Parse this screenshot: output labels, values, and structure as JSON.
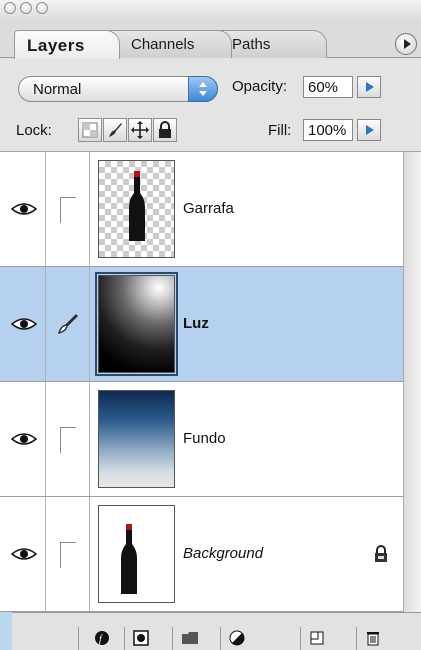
{
  "window": {
    "buttons": [
      "close",
      "minimize",
      "zoom"
    ]
  },
  "tabs": [
    {
      "label": "Layers",
      "active": true
    },
    {
      "label": "Channels",
      "active": false
    },
    {
      "label": "Paths",
      "active": false
    }
  ],
  "blend": {
    "mode": "Normal",
    "opacity_label": "Opacity:",
    "opacity_value": "60%"
  },
  "lock": {
    "label": "Lock:",
    "fill_label": "Fill:",
    "fill_value": "100%"
  },
  "layers": [
    {
      "name": "Garrafa",
      "visible": true,
      "selected": false,
      "thumb": "bottle-transparent"
    },
    {
      "name": "Luz",
      "visible": true,
      "selected": true,
      "thumb": "light-gradient"
    },
    {
      "name": "Fundo",
      "visible": true,
      "selected": false,
      "thumb": "blue-gradient"
    },
    {
      "name": "Background",
      "visible": true,
      "selected": false,
      "locked": true,
      "thumb": "bottle-white"
    }
  ],
  "colors": {
    "selection": "#b5d1ef",
    "accent": "#2f74c9"
  },
  "bottom_icons": [
    "link-layers-icon",
    "layer-style-icon",
    "mask-icon",
    "new-group-icon",
    "adjustment-layer-icon",
    "new-layer-icon",
    "trash-icon"
  ]
}
